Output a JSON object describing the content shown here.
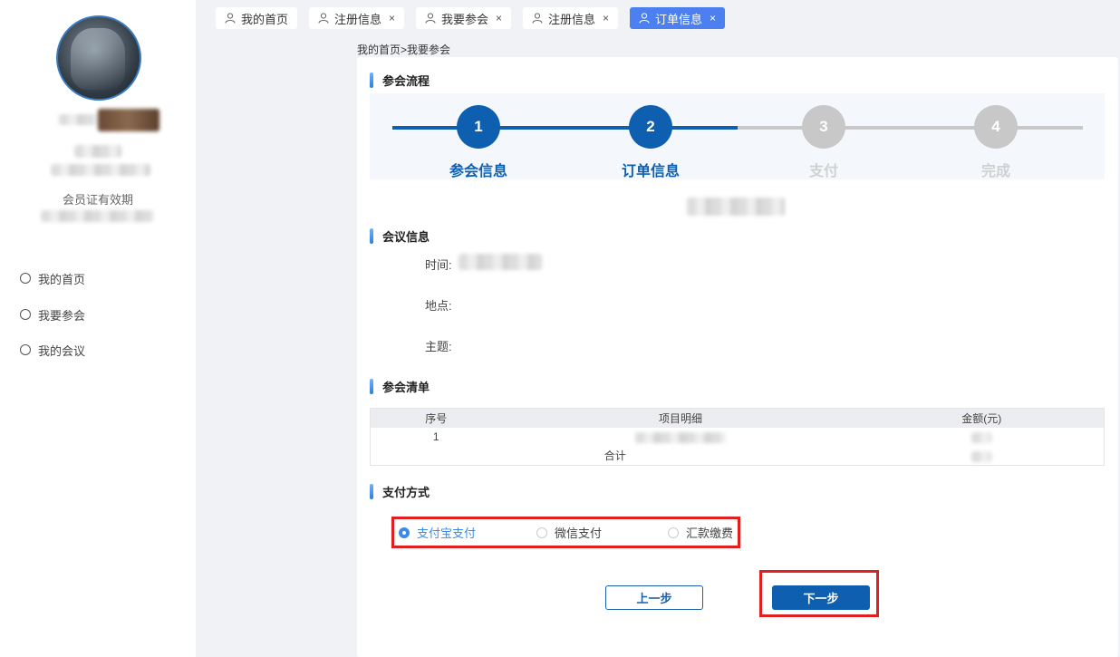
{
  "sidebar": {
    "membership_label": "会员证有效期",
    "nav": [
      {
        "label": "我的首页"
      },
      {
        "label": "我要参会"
      },
      {
        "label": "我的会议"
      }
    ]
  },
  "tabs": [
    {
      "label": "我的首页",
      "closable": false
    },
    {
      "label": "注册信息",
      "closable": true
    },
    {
      "label": "我要参会",
      "closable": true
    },
    {
      "label": "注册信息",
      "closable": true
    },
    {
      "label": "订单信息",
      "closable": true,
      "active": true
    }
  ],
  "breadcrumb": "我的首页>我要参会",
  "sections": {
    "process": "参会流程",
    "meeting": "会议信息",
    "list": "参会清单",
    "payment": "支付方式"
  },
  "steps": [
    {
      "num": "1",
      "label": "参会信息",
      "done": true
    },
    {
      "num": "2",
      "label": "订单信息",
      "done": true
    },
    {
      "num": "3",
      "label": "支付",
      "done": false
    },
    {
      "num": "4",
      "label": "完成",
      "done": false
    }
  ],
  "meeting_info": {
    "time_label": "时间:",
    "place_label": "地点:",
    "topic_label": "主题:"
  },
  "table": {
    "headers": [
      "序号",
      "项目明细",
      "金额(元)"
    ],
    "row_index": "1",
    "total_label": "合计"
  },
  "payment": {
    "options": [
      {
        "label": "支付宝支付",
        "selected": true
      },
      {
        "label": "微信支付",
        "selected": false
      },
      {
        "label": "汇款缴费",
        "selected": false
      }
    ]
  },
  "buttons": {
    "prev": "上一步",
    "next": "下一步"
  },
  "colors": {
    "primary": "#0f5fb0",
    "tab_active": "#4c7ff0",
    "step_inactive": "#c8c8c8",
    "highlight": "#e02020"
  }
}
